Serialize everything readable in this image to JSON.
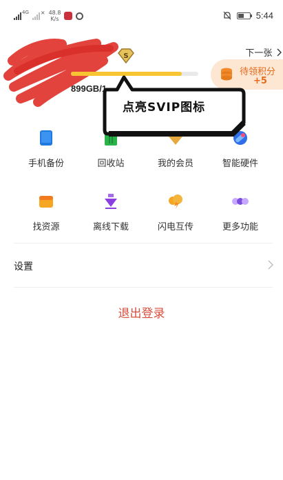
{
  "status_bar": {
    "signal1_label": "4G",
    "signal2_label": "×",
    "net_speed_value": "48.8",
    "net_speed_unit": "K/s",
    "time": "5:44"
  },
  "profile": {
    "next_label": "下一张",
    "storage_text": "899GB/1",
    "storage_fraction": 0.87,
    "badge_letter": "S"
  },
  "points": {
    "label": "待领积分",
    "value": "+5"
  },
  "callout": {
    "text": "点亮SVIP图标"
  },
  "grid": [
    {
      "label": "手机备份",
      "icon": "phone-backup-icon",
      "color": "#1f7ae0"
    },
    {
      "label": "回收站",
      "icon": "recycle-bin-icon",
      "color": "#29b34a"
    },
    {
      "label": "我的会员",
      "icon": "membership-icon",
      "color": "#e6a93d"
    },
    {
      "label": "智能硬件",
      "icon": "smart-hardware-icon",
      "color": "#2f6ee8"
    },
    {
      "label": "找资源",
      "icon": "find-resources-icon",
      "color": "#f5a623"
    },
    {
      "label": "离线下载",
      "icon": "offline-download-icon",
      "color": "#8b3fe0"
    },
    {
      "label": "闪电互传",
      "icon": "flash-transfer-icon",
      "color": "#f5a623"
    },
    {
      "label": "更多功能",
      "icon": "more-functions-icon",
      "color": "#7a4fe0"
    }
  ],
  "settings": {
    "label": "设置"
  },
  "logout": {
    "label": "退出登录"
  }
}
